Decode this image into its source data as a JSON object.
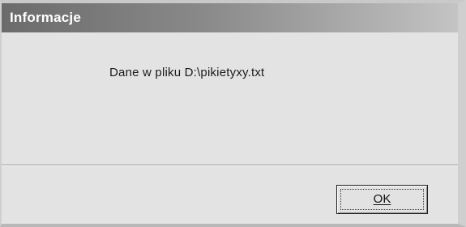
{
  "dialog": {
    "title": "Informacje",
    "message": "Dane w pliku D:\\pikietyxy.txt",
    "ok_label": "OK"
  },
  "colors": {
    "dialog_background": "#e4e3e3",
    "titlebar_start": "#6b6b6b",
    "titlebar_end": "#c4c4c4",
    "title_text": "#ffffff"
  }
}
